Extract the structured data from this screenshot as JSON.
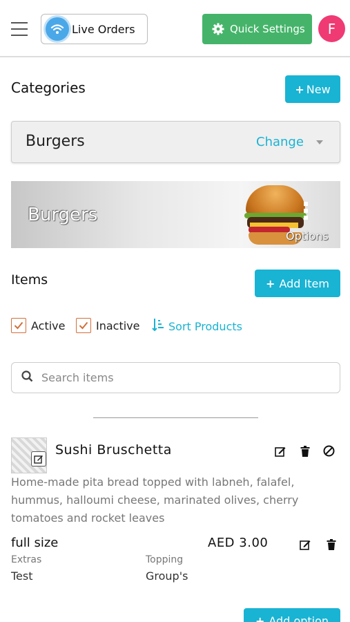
{
  "header": {
    "live_orders_label": "Live Orders",
    "quick_settings_label": "Quick Settings",
    "avatar_initial": "F"
  },
  "categories": {
    "title": "Categories",
    "new_button": "New",
    "selected": "Burgers",
    "change_label": "Change",
    "banner_title": "Burgers",
    "banner_options_label": "Options"
  },
  "items": {
    "title": "Items",
    "add_item_button": "Add Item",
    "filters": [
      {
        "label": "Active",
        "checked": true
      },
      {
        "label": "Inactive",
        "checked": true
      }
    ],
    "sort_label": "Sort Products",
    "search_placeholder": "Search items"
  },
  "product": {
    "name": "Sushi Bruschetta",
    "description": "Home-made pita bread topped with labneh, falafel, hummus, halloumi cheese, marinated olives, cherry tomatoes and rocket leaves",
    "variant": {
      "name": "full size",
      "price": "AED 3.00",
      "options": [
        {
          "label": "Extras",
          "value": "Test"
        },
        {
          "label": "Topping",
          "value": "Group's"
        }
      ]
    },
    "add_option_button": "Add option"
  },
  "colors": {
    "accent": "#19b3d3",
    "quick_settings": "#45b46a",
    "avatar": "#ef3a73",
    "checkbox": "#d0703a"
  }
}
